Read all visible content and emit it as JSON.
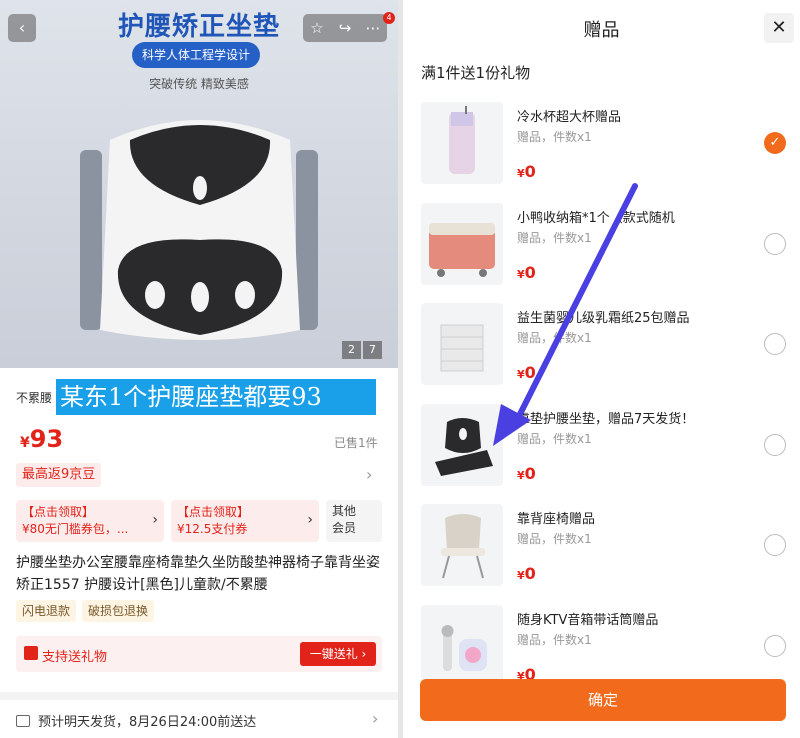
{
  "product": {
    "hero_title": "护腰矫正坐垫",
    "hero_pill": "科学人体工程学设计",
    "hero_sub": "突破传统 精致美感",
    "badge_count": "4",
    "img_index": "2",
    "img_total": "7",
    "name_prefix": "不累腰",
    "overlay_text": "某东1个护腰座垫都要93",
    "price_currency": "¥",
    "price_value": "93",
    "sold": "已售1件",
    "rebate": "最高返9京豆",
    "coupon1_line1": "【点击领取】",
    "coupon1_line2": "¥80无门槛券包，...",
    "coupon2_line1": "【点击领取】",
    "coupon2_line2": "¥12.5支付券",
    "coupon_other_1": "其他",
    "coupon_other_2": "会员",
    "description": "护腰坐垫办公室腰靠座椅靠垫久坐防酸垫神器椅子靠背坐姿矫正1557 护腰设计[黑色]儿童款/不累腰",
    "tag1": "闪电退款",
    "tag2": "破损包退换",
    "gift_label": "支持送礼物",
    "gift_button": "一键送礼 ›",
    "shipping": "预计明天发货，8月26日24:00前送达",
    "shipping_next": "..."
  },
  "gift_panel": {
    "title": "赠品",
    "subtitle": "满1件送1份礼物",
    "currency": "¥",
    "confirm": "确定",
    "items": [
      {
        "name": "冷水杯超大杯赠品",
        "meta": "赠品，件数x1",
        "price": "0",
        "selected": true
      },
      {
        "name": "小鸭收纳箱*1个（款式随机",
        "meta": "赠品，件数x1",
        "price": "0",
        "selected": false
      },
      {
        "name": "益生菌婴儿级乳霜纸25包赠品",
        "meta": "赠品，件数x1",
        "price": "0",
        "selected": false
      },
      {
        "name": "靠垫护腰坐垫，赠品7天发货！",
        "meta": "赠品，件数x1",
        "price": "0",
        "selected": false
      },
      {
        "name": "靠背座椅赠品",
        "meta": "赠品，件数x1",
        "price": "0",
        "selected": false
      },
      {
        "name": "随身KTV音箱带话筒赠品",
        "meta": "赠品，件数x1",
        "price": "0",
        "selected": false
      }
    ]
  },
  "colors": {
    "accent": "#f26a1b",
    "price_red": "#e2231a",
    "annotation_arrow": "#4a3fe0",
    "overlay_blue": "#1aa0e8"
  }
}
